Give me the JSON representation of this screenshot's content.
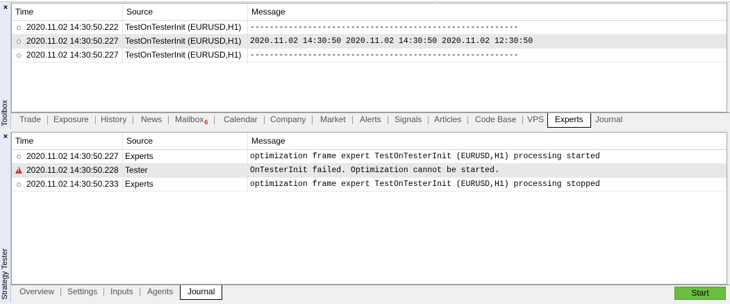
{
  "toolbox": {
    "side_label": "Toolbox",
    "close_glyph": "×",
    "columns": {
      "time": "Time",
      "source": "Source",
      "message": "Message"
    },
    "rows": [
      {
        "time": "2020.11.02 14:30:50.222",
        "source": "TestOnTesterInit (EURUSD,H1)",
        "message": "--------------------------------------------------------",
        "selected": false,
        "icon": "info-dot-icon"
      },
      {
        "time": "2020.11.02 14:30:50.227",
        "source": "TestOnTesterInit (EURUSD,H1)",
        "message": "2020.11.02 14:30:50  2020.11.02 14:30:50  2020.11.02 12:30:50",
        "selected": true,
        "icon": "info-dot-icon"
      },
      {
        "time": "2020.11.02 14:30:50.227",
        "source": "TestOnTesterInit (EURUSD,H1)",
        "message": "--------------------------------------------------------",
        "selected": false,
        "icon": "info-dot-icon"
      }
    ],
    "tabs": [
      "Trade",
      "Exposure",
      "History",
      "News",
      "Mailbox",
      "Calendar",
      "Company",
      "Market",
      "Alerts",
      "Signals",
      "Articles",
      "Code Base",
      "VPS",
      "Experts",
      "Journal"
    ],
    "mailbox_badge": "6",
    "active_tab": "Experts"
  },
  "tester": {
    "side_label": "Strategy Tester",
    "close_glyph": "×",
    "columns": {
      "time": "Time",
      "source": "Source",
      "message": "Message"
    },
    "rows": [
      {
        "time": "2020.11.02 14:30:50.227",
        "source": "Experts",
        "message": "optimization frame expert TestOnTesterInit (EURUSD,H1) processing started",
        "selected": false,
        "icon": "info-dot-icon"
      },
      {
        "time": "2020.11.02 14:30:50.228",
        "source": "Tester",
        "message": "OnTesterInit failed. Optimization cannot be started.",
        "selected": true,
        "icon": "warning-icon"
      },
      {
        "time": "2020.11.02 14:30:50.233",
        "source": "Experts",
        "message": "optimization frame expert TestOnTesterInit (EURUSD,H1) processing stopped",
        "selected": false,
        "icon": "info-dot-icon"
      }
    ],
    "tabs": [
      "Overview",
      "Settings",
      "Inputs",
      "Agents",
      "Journal"
    ],
    "active_tab": "Journal",
    "start_label": "Start"
  },
  "colors": {
    "start_button": "#6abf3f",
    "warning": "#d32f2f",
    "badge": "#e0201b"
  }
}
